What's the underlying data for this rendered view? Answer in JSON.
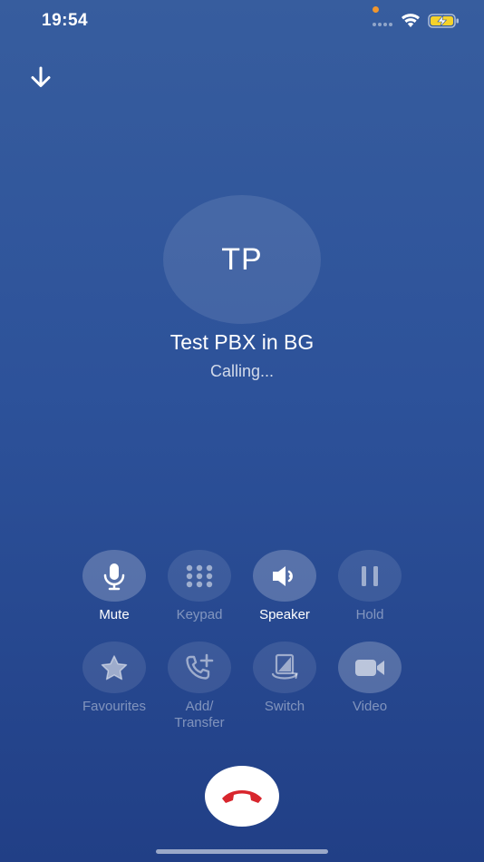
{
  "status_bar": {
    "time": "19:54"
  },
  "caller": {
    "initials": "TP",
    "name": "Test PBX in BG",
    "status": "Calling..."
  },
  "controls": {
    "mute": {
      "label": "Mute",
      "active": true
    },
    "keypad": {
      "label": "Keypad",
      "active": false
    },
    "speaker": {
      "label": "Speaker",
      "active": true
    },
    "hold": {
      "label": "Hold",
      "active": false
    },
    "favourites": {
      "label": "Favourites",
      "active": false
    },
    "add_transfer": {
      "label": "Add/\nTransfer",
      "active": false
    },
    "switch": {
      "label": "Switch",
      "active": false
    },
    "video": {
      "label": "Video",
      "active": false
    }
  },
  "icons": {
    "minimize": "arrow-down-icon",
    "end_call": "hang-up-icon"
  },
  "colors": {
    "background_top": "#375d9e",
    "background_bottom": "#213f86",
    "end_call_red": "#d8262d",
    "privacy_dot": "#f0962e",
    "battery_yellow": "#f5d22a"
  }
}
